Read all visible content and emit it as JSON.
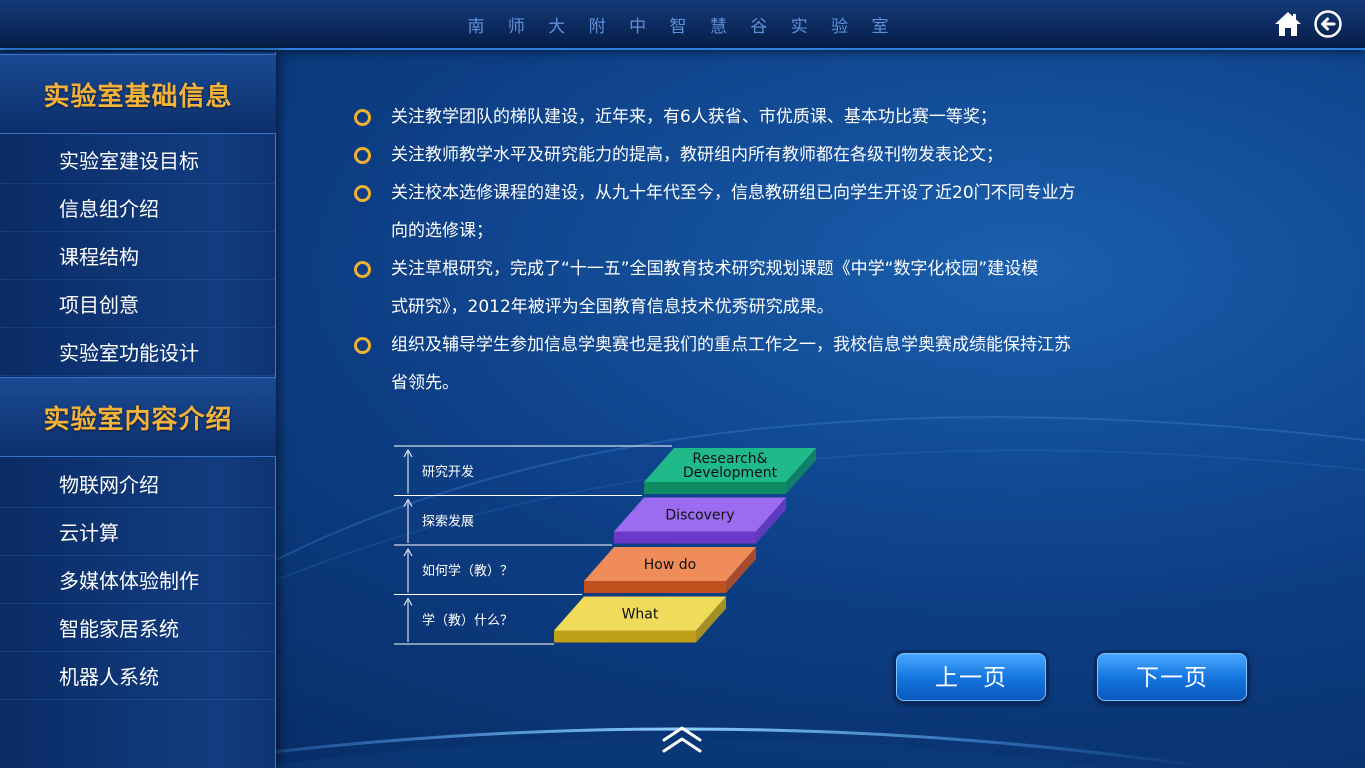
{
  "header": {
    "title": "南 师 大 附 中 智 慧 谷 实 验 室",
    "home_icon": "home-icon",
    "back_icon": "back-arrow-icon"
  },
  "sidebar": {
    "section1": {
      "title": "实验室基础信息",
      "items": [
        "实验室建设目标",
        "信息组介绍",
        "课程结构",
        "项目创意",
        "实验室功能设计"
      ]
    },
    "section2": {
      "title": "实验室内容介绍",
      "items": [
        "物联网介绍",
        "云计算",
        "多媒体体验制作",
        "智能家居系统",
        "机器人系统"
      ]
    }
  },
  "content": {
    "bullets": [
      [
        "关注教学团队的梯队建设，近年来，有6人获省、市优质课、基本功比赛一等奖；"
      ],
      [
        "关注教师教学水平及研究能力的提高，教研组内所有教师都在各级刊物发表论文；"
      ],
      [
        "关注校本选修课程的建设，从九十年代至今，信息教研组已向学生开设了近20门不同专业方",
        "向的选修课；"
      ],
      [
        "关注草根研究，完成了“十一五”全国教育技术研究规划课题《中学“数字化校园”建设模",
        "式研究》，2012年被评为全国教育信息技术优秀研究成果。"
      ],
      [
        "组织及辅导学生参加信息学奥赛也是我们的重点工作之一，我校信息学奥赛成绩能保持江苏",
        "省领先。"
      ]
    ]
  },
  "diagram": {
    "rows": [
      {
        "left_label": "研究开发",
        "step_label_lines": [
          "Research&",
          "Development"
        ],
        "color": "#1fb98a",
        "side": "#0f8a62"
      },
      {
        "left_label": "探索发展",
        "step_label_lines": [
          "Discovery"
        ],
        "color": "#9b6cf0",
        "side": "#6b38c8"
      },
      {
        "left_label": "如何学（教）？",
        "step_label_lines": [
          "How do"
        ],
        "color": "#f08c5a",
        "side": "#c0501e"
      },
      {
        "left_label": "学（教）什么？",
        "step_label_lines": [
          "What"
        ],
        "color": "#f0dc5a",
        "side": "#c0a018"
      }
    ]
  },
  "buttons": {
    "prev": "上一页",
    "next": "下一页"
  },
  "footer": {
    "up_icon": "double-chevron-up-icon"
  },
  "colors": {
    "accent_orange": "#f4b23a",
    "button_blue": "#1677e0",
    "header_text": "#5f8fd8"
  }
}
